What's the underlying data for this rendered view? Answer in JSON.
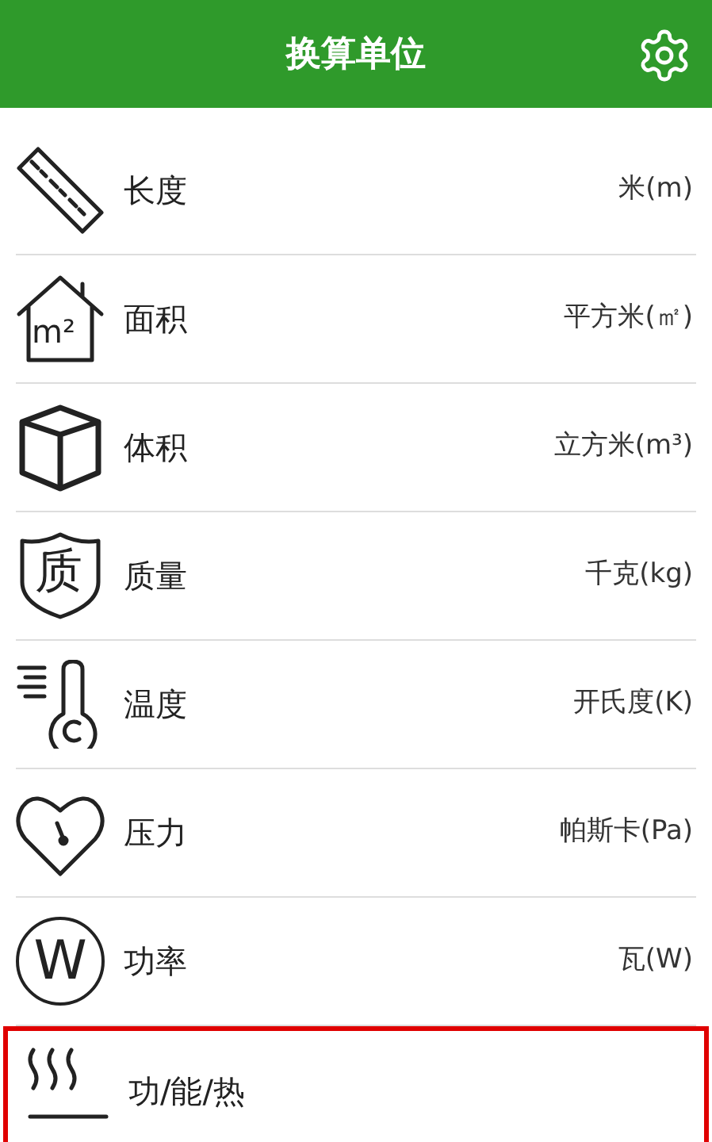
{
  "header": {
    "title": "换算单位"
  },
  "items": [
    {
      "kind": "ruler",
      "label": "长度",
      "unit": "米(m)",
      "highlighted": false
    },
    {
      "kind": "house",
      "label": "面积",
      "unit": "平方米(㎡)",
      "icon_text": "m²",
      "highlighted": false
    },
    {
      "kind": "cube",
      "label": "体积",
      "unit": "立方米(m³)",
      "highlighted": false
    },
    {
      "kind": "shield",
      "label": "质量",
      "unit": "千克(kg)",
      "icon_text": "质",
      "highlighted": false
    },
    {
      "kind": "thermometer",
      "label": "温度",
      "unit": "开氏度(K)",
      "highlighted": false
    },
    {
      "kind": "heart",
      "label": "压力",
      "unit": "帕斯卡(Pa)",
      "highlighted": false
    },
    {
      "kind": "circle",
      "label": "功率",
      "unit": "瓦(W)",
      "icon_text": "W",
      "highlighted": false
    },
    {
      "kind": "heat",
      "label": "功/能/热",
      "highlighted": true
    }
  ]
}
